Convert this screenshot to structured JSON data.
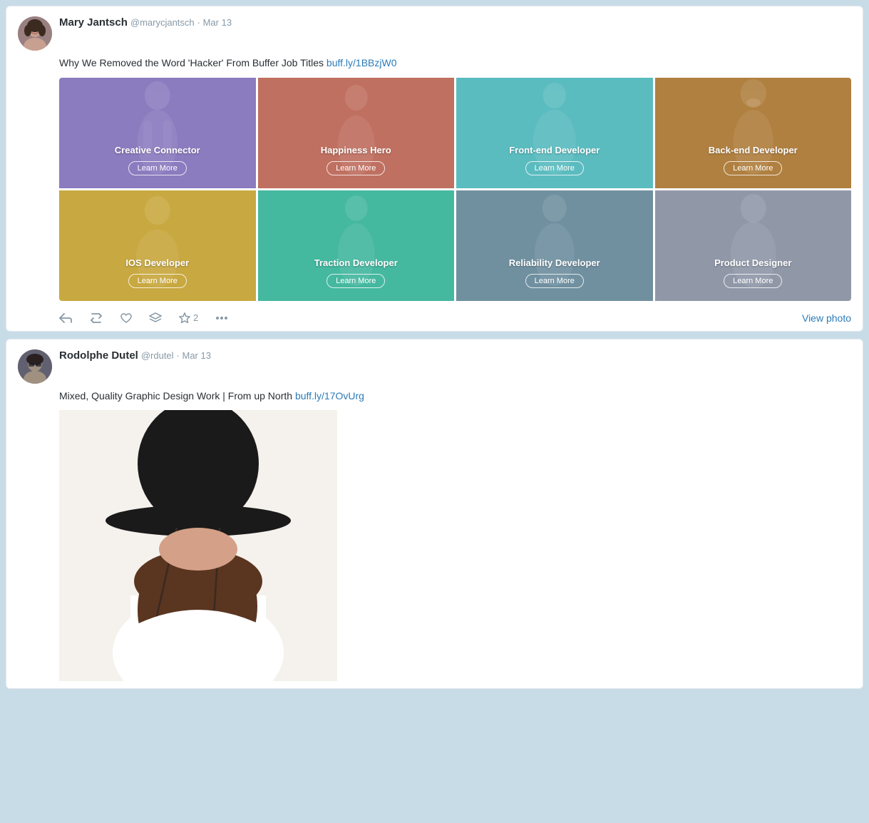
{
  "tweet1": {
    "author_name": "Mary Jantsch",
    "author_handle": "@marycjantsch",
    "date": "· Mar 13",
    "tweet_text": "Why We Removed the Word 'Hacker' From Buffer Job Titles",
    "tweet_link_text": "buff.ly/1BBzjW0",
    "tweet_link_url": "#",
    "grid_cells": [
      {
        "label": "Creative Connector",
        "btn": "Learn More",
        "color": "cell-purple"
      },
      {
        "label": "Happiness Hero",
        "btn": "Learn More",
        "color": "cell-red"
      },
      {
        "label": "Front-end Developer",
        "btn": "Learn More",
        "color": "cell-teal"
      },
      {
        "label": "Back-end Developer",
        "btn": "Learn More",
        "color": "cell-brown"
      },
      {
        "label": "IOS Developer",
        "btn": "Learn More",
        "color": "cell-yellow"
      },
      {
        "label": "Traction Developer",
        "btn": "Learn More",
        "color": "cell-green"
      },
      {
        "label": "Reliability Developer",
        "btn": "Learn More",
        "color": "cell-gray-blue"
      },
      {
        "label": "Product Designer",
        "btn": "Learn More",
        "color": "cell-gray"
      }
    ],
    "actions": {
      "reply_label": "Reply",
      "retweet_label": "Retweet",
      "heart_label": "Favorite",
      "more_label": "More",
      "star_count": "2",
      "view_photo": "View photo"
    }
  },
  "tweet2": {
    "author_name": "Rodolphe Dutel",
    "author_handle": "@rdutel",
    "date": "· Mar 13",
    "tweet_text": "Mixed, Quality Graphic Design Work | From up North",
    "tweet_link_text": "buff.ly/17OvUrg",
    "tweet_link_url": "#"
  }
}
